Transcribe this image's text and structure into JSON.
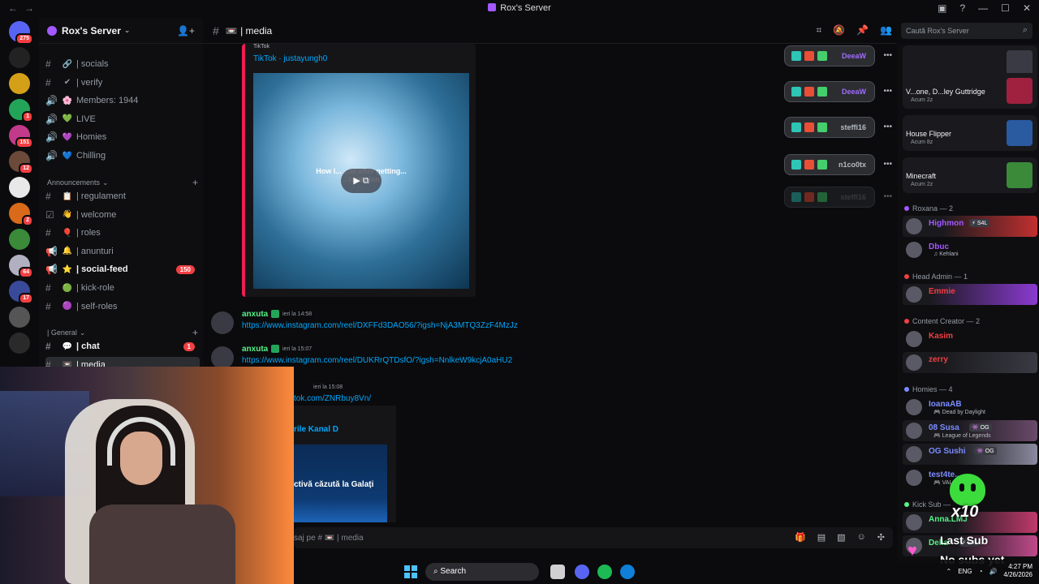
{
  "window": {
    "title": "Rox's Server",
    "nav_back": "←",
    "nav_forward": "→"
  },
  "server_list": {
    "items": [
      {
        "name": "direct-messages",
        "badge": "275"
      },
      {
        "name": "server-w",
        "badge": ""
      },
      {
        "name": "server-gold",
        "badge": ""
      },
      {
        "name": "server-green",
        "badge": "1"
      },
      {
        "name": "server-pink",
        "badge": "151"
      },
      {
        "name": "server-cat",
        "badge": "12"
      },
      {
        "name": "server-white",
        "badge": ""
      },
      {
        "name": "server-orange",
        "badge": "2"
      },
      {
        "name": "server-leaf",
        "badge": ""
      },
      {
        "name": "server-anime",
        "badge": "64"
      },
      {
        "name": "server-blue",
        "badge": "17"
      },
      {
        "name": "server-x",
        "badge": ""
      },
      {
        "name": "server-wzg",
        "badge": ""
      }
    ]
  },
  "sidebar": {
    "server_name": "Rox's Server",
    "channels_top": [
      {
        "prefix": "#",
        "emoji": "🔗",
        "label": "| socials"
      },
      {
        "prefix": "#",
        "emoji": "✔",
        "label": "| verify"
      },
      {
        "prefix": "🔊",
        "emoji": "🌸",
        "label": "Members: 1944"
      },
      {
        "prefix": "🔊",
        "emoji": "💚",
        "label": "LIVE"
      },
      {
        "prefix": "🔊",
        "emoji": "💜",
        "label": "Homies"
      },
      {
        "prefix": "🔊",
        "emoji": "💙",
        "label": "Chilling"
      }
    ],
    "category_announcements": "Announcements",
    "channels_announcements": [
      {
        "prefix": "#",
        "emoji": "📋",
        "label": "| regulament"
      },
      {
        "prefix": "☑",
        "emoji": "👋",
        "label": "| welcome"
      },
      {
        "prefix": "#",
        "emoji": "🎈",
        "label": "| roles"
      },
      {
        "prefix": "📢",
        "emoji": "🔔",
        "label": "| anunturi"
      },
      {
        "prefix": "📢",
        "emoji": "⭐",
        "label": "| social-feed",
        "badge": "150"
      },
      {
        "prefix": "#",
        "emoji": "🟢",
        "label": "| kick-role"
      },
      {
        "prefix": "#",
        "emoji": "🟣",
        "label": "| self-roles"
      }
    ],
    "category_general": "| General",
    "channels_general": [
      {
        "prefix": "#",
        "emoji": "💬",
        "label": "| chat",
        "badge": "1"
      },
      {
        "prefix": "#",
        "emoji": "📼",
        "label": "| media"
      }
    ]
  },
  "header": {
    "channel_name": "📼 | media",
    "search_placeholder": "Caută Rox's Server"
  },
  "embed": {
    "provider": "TikTok",
    "author": "TikTok · justayungh0",
    "caption": "How I... ...st after getting... ...termelon"
  },
  "messages": [
    {
      "user": "anxuta",
      "time": "ieri la 14:58",
      "link": "https://www.instagram.com/reel/DXFFd3DAO56/?igsh=NjA3MTQ3ZzF4MzJz"
    },
    {
      "user": "anxuta",
      "time": "ieri la 15:07",
      "link": "https://www.instagram.com/reel/DUKRrQTDsfO/?igsh=NnlkeW9kcjA0aHU2"
    }
  ],
  "partial_message": {
    "time": "ieri la 15:08",
    "link": "tok.com/ZNRbuy8Vn/",
    "embed_title": "rile Kanal D",
    "embed_image_text": "ctivă căzută la Galați"
  },
  "composer": {
    "placeholder": "saj pe # 📼 | media"
  },
  "reactions": [
    {
      "name": "DeeaW",
      "color": "#a06bff"
    },
    {
      "name": "DeeaW",
      "color": "#a06bff"
    },
    {
      "name": "steffi16",
      "color": "#b5bac1"
    },
    {
      "name": "n1co0tx",
      "color": "#b5bac1"
    },
    {
      "name": "steffi16",
      "color": "#6d6f78"
    }
  ],
  "members": {
    "activities": [
      {
        "label": "",
        "sub": ""
      },
      {
        "label": "V...one, D...ley Guttridge",
        "sub": "Acum 2z"
      },
      {
        "label": "House Flipper",
        "sub": "Acum 8z"
      },
      {
        "label": "Minecraft",
        "sub": "Acum 2z"
      }
    ],
    "sections": [
      {
        "title": "Roxana — 2",
        "members": [
          {
            "name": "Highmon",
            "status": "",
            "color": "#a259ff",
            "pill": "⚡ S4L"
          },
          {
            "name": "Dbuc",
            "status": "♫ Kehlani",
            "color": "#a259ff",
            "pill": ""
          }
        ]
      },
      {
        "title": "Head Admin — 1",
        "members": [
          {
            "name": "Emmie",
            "status": "",
            "color": "#f23f42",
            "pill": ""
          }
        ]
      },
      {
        "title": "Content Creator — 2",
        "members": [
          {
            "name": "Kasim",
            "status": "",
            "color": "#f23f42",
            "pill": ""
          },
          {
            "name": "zerry",
            "status": "",
            "color": "#f23f42",
            "pill": ""
          }
        ]
      },
      {
        "title": "Homies — 4",
        "members": [
          {
            "name": "IoanaAB",
            "status": "🎮 Dead by Daylight",
            "color": "#7b8cff",
            "pill": ""
          },
          {
            "name": "08 Susa",
            "status": "🎮 League of Legends",
            "color": "#7b8cff",
            "pill": "👾 OG"
          },
          {
            "name": "OG Sushi",
            "status": "",
            "color": "#7b8cff",
            "pill": "👾 OG"
          },
          {
            "name": "test4te...",
            "status": "🎮 VAL...",
            "color": "#7b8cff",
            "pill": ""
          }
        ]
      },
      {
        "title": "Kick Sub —",
        "members": [
          {
            "name": "Anna.LMJ",
            "status": "",
            "color": "#57f287",
            "pill": ""
          },
          {
            "name": "Delia",
            "status": "",
            "color": "#57f287",
            "pill": "⚡ S4L"
          }
        ]
      }
    ]
  },
  "overlay": {
    "multiplier": "x10",
    "line1": "Last Sub",
    "line2": "No subs yet"
  },
  "taskbar": {
    "search_label": "Search",
    "lang": "ENG",
    "time": "4:27 PM",
    "date": "4/26/2026"
  }
}
